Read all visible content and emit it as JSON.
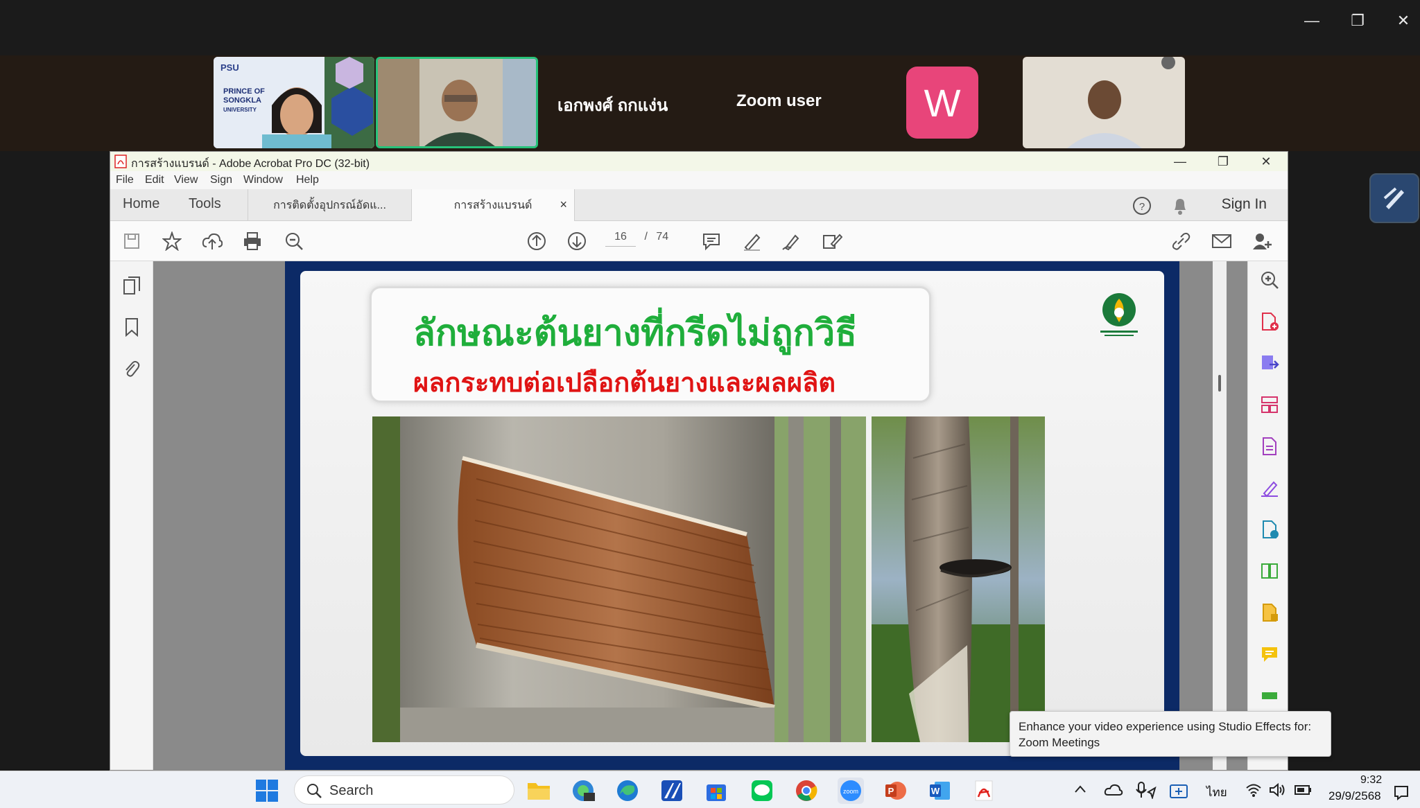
{
  "zoom": {
    "participants": [
      {
        "name": "เอกพงศ์ ถกแง่น"
      },
      {
        "name": "Zoom user"
      },
      {
        "avatar_letter": "W"
      }
    ],
    "university_logo_lines": [
      "PRINCE OF",
      "SONGKLA",
      "UNIVERSITY"
    ],
    "toast": "Enhance your video experience using Studio Effects for: Zoom Meetings"
  },
  "acrobat": {
    "window_title": "การสร้างแบรนด์ - Adobe Acrobat Pro DC (32-bit)",
    "menu": [
      "File",
      "Edit",
      "View",
      "Sign",
      "Window",
      "Help"
    ],
    "nav": {
      "home": "Home",
      "tools": "Tools"
    },
    "tabs": [
      {
        "label": "การติดตั้งอุปกรณ์อัดแ..."
      },
      {
        "label": "การสร้างแบรนด์",
        "close": "×"
      }
    ],
    "sign_in": "Sign In",
    "page": {
      "current": "16",
      "separator": "/",
      "total": "74"
    }
  },
  "slide": {
    "title": "ลักษณะต้นยางที่กรีดไม่ถูกวิธี",
    "subtitle": "ผลกระทบต่อเปลือกต้นยางและผลผลิต",
    "title_color": "#1fae3b",
    "subtitle_color": "#e01414"
  },
  "taskbar": {
    "search_label": "Search",
    "language": "ไทย",
    "time": "9:32",
    "date": "29/9/2568"
  }
}
